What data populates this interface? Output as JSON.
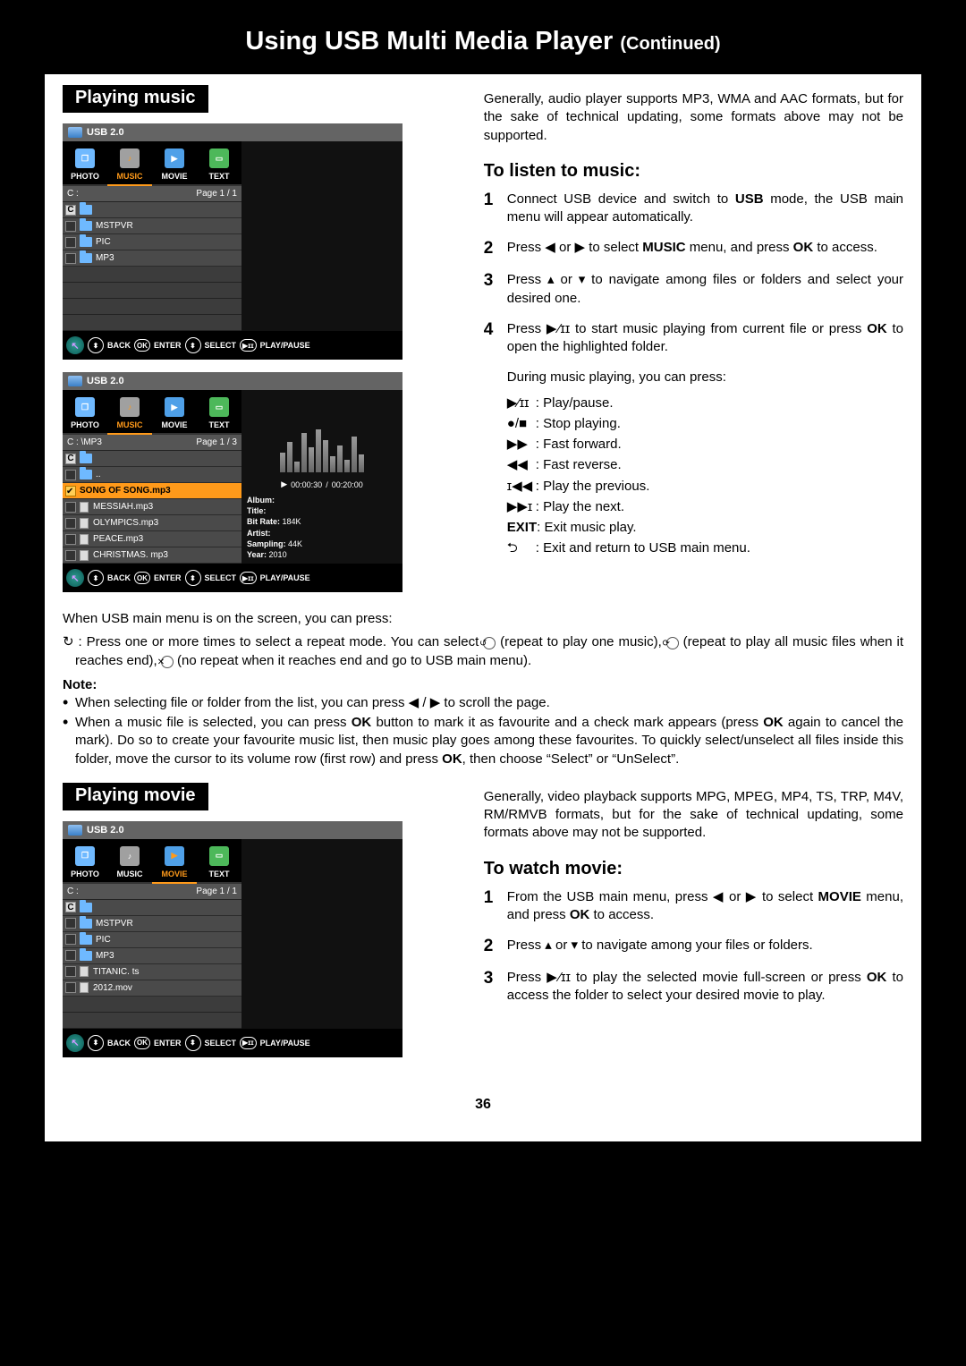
{
  "page_title": "Using USB Multi Media Player",
  "page_title_cont": "(Continued)",
  "page_number": "36",
  "music": {
    "section_label": "Playing music",
    "intro": "Generally, audio player supports MP3, WMA and AAC formats, but for the sake of technical updating, some formats above may not be supported.",
    "listen_heading": "To listen to music:",
    "steps": [
      "Connect USB device and switch to USB mode, the USB main menu will appear automatically.",
      "Press ◀ or ▶ to select MUSIC menu, and press OK to access.",
      "Press ▴ or ▾ to navigate among files or folders and select your desired one.",
      "Press ▶⁄ɪɪ to start music playing from current file or press OK to open the highlighted folder."
    ],
    "during": "During music playing, you can press:",
    "controls": [
      {
        "sym": "▶⁄ɪɪ",
        "desc": ": Play/pause."
      },
      {
        "sym": "●/■",
        "desc": ": Stop playing."
      },
      {
        "sym": "▶▶",
        "desc": ": Fast forward."
      },
      {
        "sym": "◀◀",
        "desc": ": Fast reverse."
      },
      {
        "sym": "ɪ◀◀",
        "desc": ": Play the previous."
      },
      {
        "sym": "▶▶ɪ",
        "desc": ": Play the next."
      },
      {
        "sym": "EXIT",
        "desc": ": Exit music play."
      },
      {
        "sym": "⮌",
        "desc": ": Exit and return to USB main menu."
      }
    ],
    "back_on_screen": "When USB main menu is on the screen, you can press:",
    "repeat_line_1": "↻ : Press one or more times to select a repeat mode. You can select ",
    "repeat_opt1": "(repeat to play one music), ",
    "repeat_opt2": "(repeat to play all music files when it reaches end), ",
    "repeat_opt3": "(no repeat when it reaches end and go to USB main menu).",
    "note_head": "Note:",
    "notes": [
      "When selecting file or folder from the list, you can press ◀ / ▶ to scroll the page.",
      "When a music file is selected, you can press OK button to mark it as favourite and a check mark appears (press OK again to cancel the mark). Do so to create your favourite music list, then music play goes among these favourites. To quickly select/unselect all files inside this folder, move the cursor to its volume row (first row) and press OK, then choose “Select” or “UnSelect”."
    ],
    "osd1": {
      "title": "USB 2.0",
      "tabs": [
        "PHOTO",
        "MUSIC",
        "MOVIE",
        "TEXT"
      ],
      "active_tab": "MUSIC",
      "path": "C :",
      "page": "Page 1 / 1",
      "drive": "C",
      "folders": [
        "MSTPVR",
        "PIC",
        "MP3"
      ],
      "foot": {
        "back": "BACK",
        "enter": "ENTER",
        "select": "SELECT",
        "pp": "PLAY/PAUSE",
        "ok": "OK"
      }
    },
    "osd2": {
      "title": "USB 2.0",
      "tabs": [
        "PHOTO",
        "MUSIC",
        "MOVIE",
        "TEXT"
      ],
      "active_tab": "MUSIC",
      "path": "C :  \\MP3",
      "page": "Page 1 / 3",
      "drive": "C",
      "up": "..",
      "highlight": "SONG OF SONG.mp3",
      "files": [
        "MESSIAH.mp3",
        "OLYMPICS.mp3",
        "PEACE.mp3",
        "CHRISTMAS. mp3"
      ],
      "time_cur": "00:00:30",
      "time_tot": "00:20:00",
      "meta": {
        "album": "Album:",
        "title": "Title:",
        "bitrate_lbl": "Bit Rate:",
        "bitrate": "184K",
        "artist": "Artist:",
        "sampling_lbl": "Sampling:",
        "sampling": "44K",
        "year_lbl": "Year:",
        "year": "2010"
      },
      "foot": {
        "back": "BACK",
        "enter": "ENTER",
        "select": "SELECT",
        "pp": "PLAY/PAUSE",
        "ok": "OK"
      }
    }
  },
  "movie": {
    "section_label": "Playing movie",
    "intro": "Generally, video playback supports MPG, MPEG, MP4, TS, TRP, M4V, RM/RMVB formats, but for the sake of technical updating, some formats above may not be supported.",
    "watch_heading": "To watch movie:",
    "steps": [
      "From the USB main menu, press ◀ or ▶ to select MOVIE menu, and press OK to access.",
      "Press ▴ or ▾ to navigate among your files or folders.",
      "Press ▶⁄ɪɪ to play the selected movie full-screen or press OK to access the folder to select your desired movie to play."
    ],
    "osd": {
      "title": "USB 2.0",
      "tabs": [
        "PHOTO",
        "MUSIC",
        "MOVIE",
        "TEXT"
      ],
      "active_tab": "MOVIE",
      "path": "C :",
      "page": "Page 1 / 1",
      "drive": "C",
      "folders": [
        "MSTPVR",
        "PIC",
        "MP3"
      ],
      "files": [
        "TITANIC. ts",
        "2012.mov"
      ],
      "foot": {
        "back": "BACK",
        "enter": "ENTER",
        "select": "SELECT",
        "pp": "PLAY/PAUSE",
        "ok": "OK"
      }
    }
  }
}
